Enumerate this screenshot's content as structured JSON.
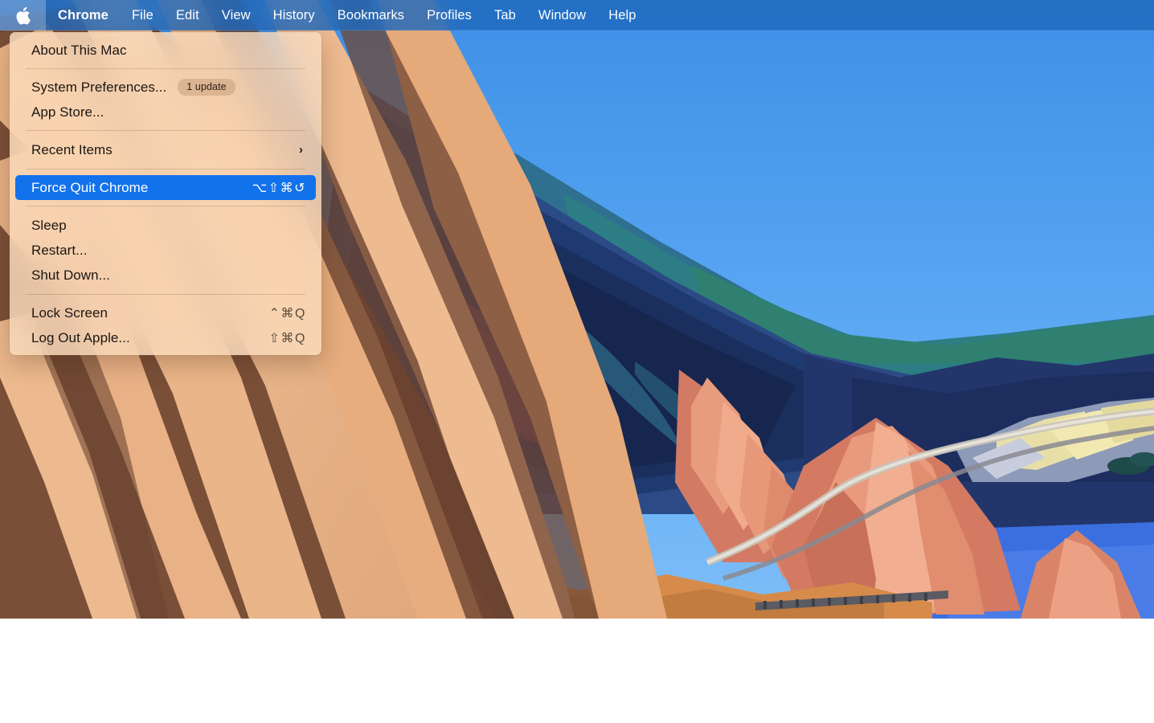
{
  "menubar": {
    "apple_icon": "apple-logo-icon",
    "items": [
      {
        "label": "Chrome",
        "bold": true
      },
      {
        "label": "File",
        "bold": false
      },
      {
        "label": "Edit",
        "bold": false
      },
      {
        "label": "View",
        "bold": false
      },
      {
        "label": "History",
        "bold": false
      },
      {
        "label": "Bookmarks",
        "bold": false
      },
      {
        "label": "Profiles",
        "bold": false
      },
      {
        "label": "Tab",
        "bold": false
      },
      {
        "label": "Window",
        "bold": false
      },
      {
        "label": "Help",
        "bold": false
      }
    ],
    "background_color": "#1d68bd",
    "text_color": "#ffffff"
  },
  "apple_menu": {
    "highlight_color": "#1272ec",
    "panel_color": "#f7dcc0",
    "items": {
      "about_this_mac": {
        "label": "About This Mac"
      },
      "system_preferences": {
        "label": "System Preferences...",
        "badge": "1 update"
      },
      "app_store": {
        "label": "App Store..."
      },
      "recent_items": {
        "label": "Recent Items",
        "submenu_indicator": "›"
      },
      "force_quit": {
        "label": "Force Quit Chrome",
        "shortcut": "⌥⇧⌘↺",
        "selected": true
      },
      "sleep": {
        "label": "Sleep"
      },
      "restart": {
        "label": "Restart..."
      },
      "shut_down": {
        "label": "Shut Down..."
      },
      "lock_screen": {
        "label": "Lock Screen",
        "shortcut": "⌃⌘Q"
      },
      "log_out": {
        "label": "Log Out Apple...",
        "shortcut": "⇧⌘Q"
      }
    }
  },
  "desktop": {
    "wallpaper_name": "big-sur-canyon-wallpaper",
    "sky_color": "#4e9ef0",
    "sand_light": "#eab588",
    "sand_dark": "#6b4431",
    "mountain_blue": "#1d2c5c",
    "mountain_salmon": "#e08a6e",
    "water_blue": "#3b6fe0"
  }
}
